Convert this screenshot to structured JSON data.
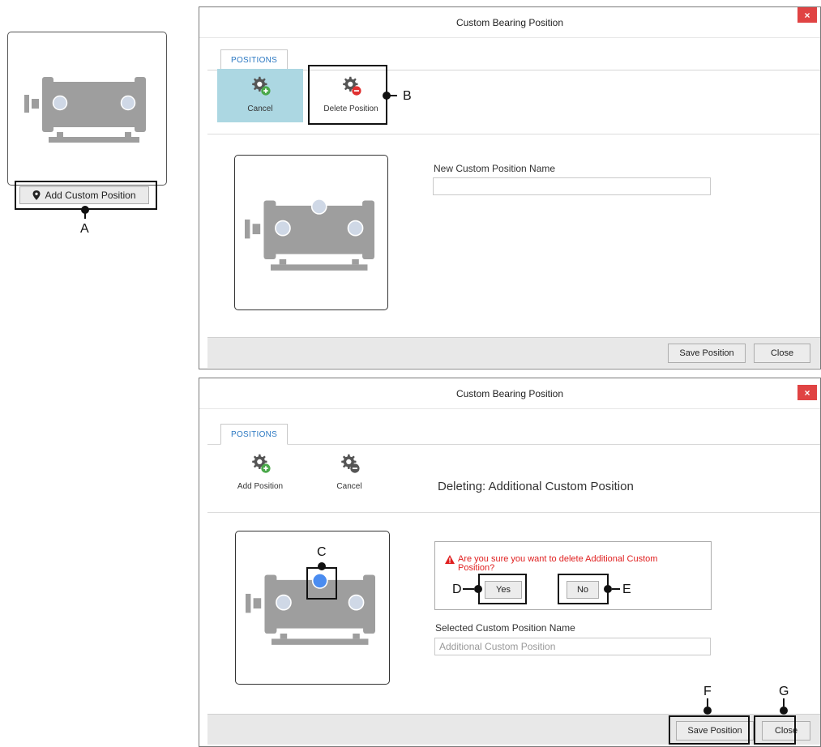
{
  "thumbnail": {
    "add_button_label": "Add Custom Position",
    "callout": "A"
  },
  "dialog_top": {
    "title": "Custom Bearing Position",
    "close_label": "×",
    "tab_label": "POSITIONS",
    "tools": [
      {
        "label": "Cancel",
        "icon": "gear-add-icon",
        "active": true
      },
      {
        "label": "Delete Position",
        "icon": "gear-delete-icon",
        "active": false
      }
    ],
    "tool_callout": "B",
    "field_label": "New Custom Position Name",
    "field_value": "",
    "save_label": "Save Position",
    "close_button_label": "Close"
  },
  "dialog_bottom": {
    "title": "Custom Bearing Position",
    "close_label": "×",
    "tab_label": "POSITIONS",
    "tools": [
      {
        "label": "Add Position",
        "icon": "gear-add-icon"
      },
      {
        "label": "Cancel",
        "icon": "gear-delete-icon"
      }
    ],
    "deleting_title": "Deleting: Additional Custom Position",
    "confirm_text": "Are you sure you want to delete Additional Custom Position?",
    "yes_label": "Yes",
    "no_label": "No",
    "field_label": "Selected Custom Position Name",
    "field_value": "Additional Custom Position",
    "save_label": "Save Position",
    "close_button_label": "Close",
    "callouts": {
      "c": "C",
      "d": "D",
      "e": "E",
      "f": "F",
      "g": "G"
    }
  },
  "colors": {
    "active_tool": "#acd7e2",
    "tab_text": "#2b78c2",
    "close_button": "#e04343",
    "warning": "#e02020",
    "selected_bearing": "#4a8cf0",
    "machine": "#9e9e9e"
  }
}
